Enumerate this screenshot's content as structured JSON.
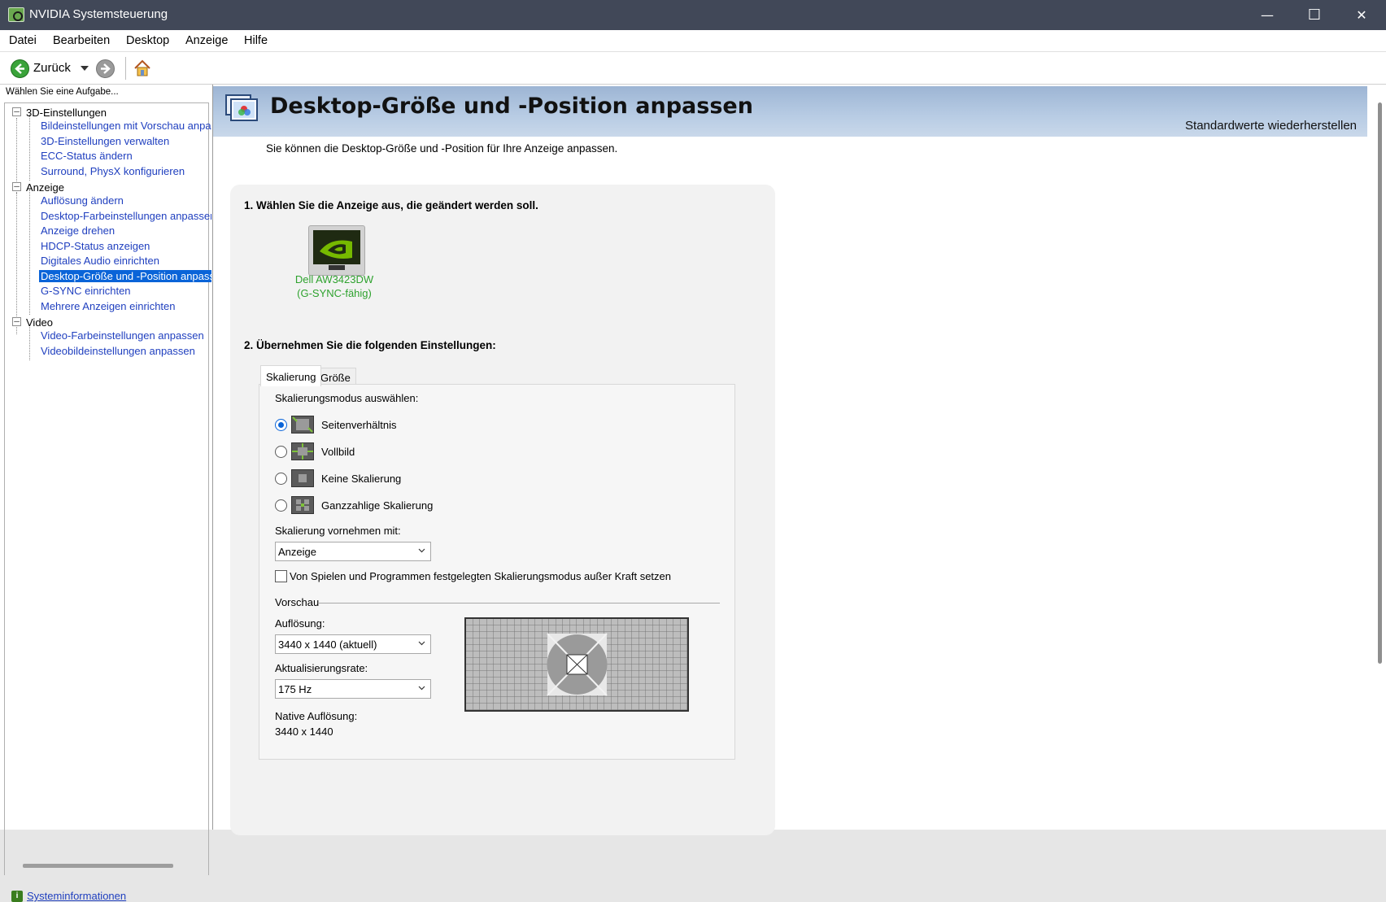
{
  "window": {
    "title": "NVIDIA Systemsteuerung",
    "minimize": "—",
    "maximize": "☐",
    "close": "✕"
  },
  "menu": [
    "Datei",
    "Bearbeiten",
    "Desktop",
    "Anzeige",
    "Hilfe"
  ],
  "toolbar": {
    "back_label": "Zurück"
  },
  "sidebar": {
    "task_label": "Wählen Sie eine Aufgabe...",
    "groups": [
      {
        "label": "3D-Einstellungen",
        "items": [
          "Bildeinstellungen mit Vorschau anpassen",
          "3D-Einstellungen verwalten",
          "ECC-Status ändern",
          "Surround, PhysX konfigurieren"
        ]
      },
      {
        "label": "Anzeige",
        "items": [
          "Auflösung ändern",
          "Desktop-Farbeinstellungen anpassen",
          "Anzeige drehen",
          "HDCP-Status anzeigen",
          "Digitales Audio einrichten",
          "Desktop-Größe und -Position anpassen",
          "G-SYNC einrichten",
          "Mehrere Anzeigen einrichten"
        ]
      },
      {
        "label": "Video",
        "items": [
          "Video-Farbeinstellungen anpassen",
          "Videobildeinstellungen anpassen"
        ]
      }
    ],
    "selected": "Desktop-Größe und -Position anpassen",
    "sysinfo": "Systeminformationen"
  },
  "main": {
    "title": "Desktop-Größe und -Position anpassen",
    "restore": "Standardwerte wiederherstellen",
    "intro": "Sie können die Desktop-Größe und -Position für Ihre Anzeige anpassen.",
    "step1": "1. Wählen Sie die Anzeige aus, die geändert werden soll.",
    "monitor_name": "Dell AW3423DW",
    "monitor_sub": "(G-SYNC-fähig)",
    "step2": "2. Übernehmen Sie die folgenden Einstellungen:",
    "tabs": [
      "Skalierung",
      "Größe"
    ],
    "scaling_mode_label": "Skalierungsmodus auswählen:",
    "scaling_modes": [
      "Seitenverhältnis",
      "Vollbild",
      "Keine Skalierung",
      "Ganzzahlige Skalierung"
    ],
    "selected_mode": "Seitenverhältnis",
    "perform_label": "Skalierung vornehmen mit:",
    "perform_value": "Anzeige",
    "override_label": "Von Spielen und Programmen festgelegten Skalierungsmodus außer Kraft setzen",
    "override_checked": false,
    "preview_label": "Vorschau",
    "resolution_label": "Auflösung:",
    "resolution_value": "3440 x 1440 (aktuell)",
    "refresh_label": "Aktualisierungsrate:",
    "refresh_value": "175 Hz",
    "native_label": "Native Auflösung:",
    "native_value": "3440 x 1440"
  },
  "colors": {
    "accent": "#0a64d8",
    "link": "#1f3fbf",
    "nvidia_green": "#76b900",
    "titlebar": "#414858"
  }
}
